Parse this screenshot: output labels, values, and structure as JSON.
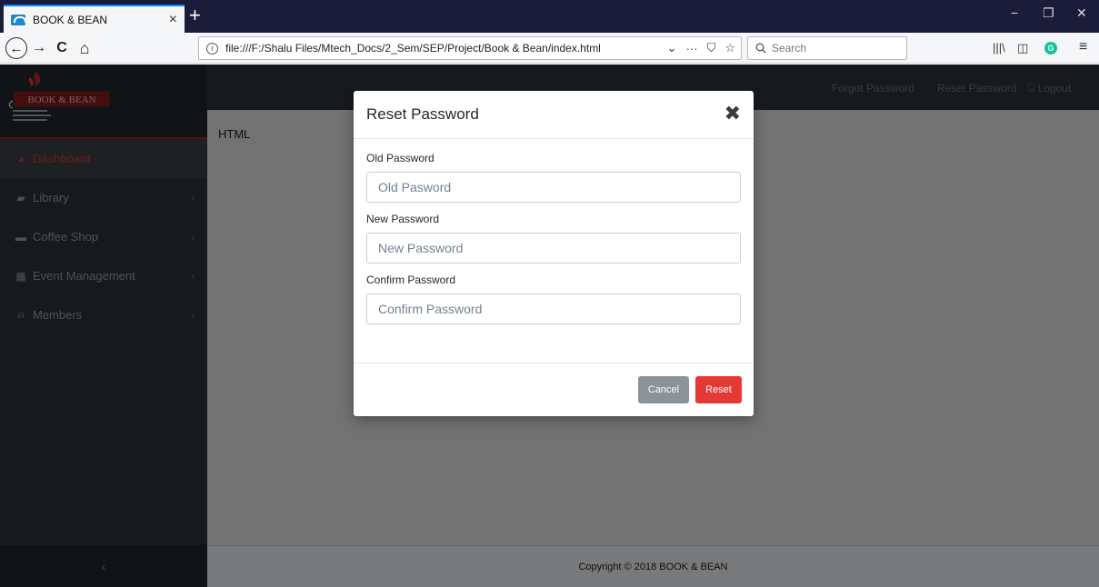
{
  "browser": {
    "tab_title": "BOOK & BEAN",
    "tab_close": "×",
    "new_tab": "+",
    "url": "file:///F:/Shalu Files/Mtech_Docs/2_Sem/SEP/Project/Book & Bean/index.html",
    "search_placeholder": "Search",
    "minimize": "−",
    "restore": "❐",
    "close": "✕",
    "back": "←",
    "forward": "→",
    "reload": "C",
    "home": "⌂",
    "url_dropdown": "⌄",
    "url_more": "···",
    "pocket": "⛉",
    "bookmark": "☆",
    "library": "|||\\",
    "sidebar_toggle": "◫",
    "grammarly": "G",
    "menu": "≡"
  },
  "brand": {
    "logo_text": "BOOK & BEAN",
    "colors": {
      "flame": "#c62828",
      "badge": "#8b1a1a"
    }
  },
  "sidebar": {
    "items": [
      {
        "label": "Dashboard",
        "icon": "dashboard-icon",
        "glyph": "◕",
        "active": true
      },
      {
        "label": "Library",
        "icon": "book-icon",
        "glyph": "▰",
        "chevron": "›"
      },
      {
        "label": "Coffee Shop",
        "icon": "coffee-icon",
        "glyph": "▬",
        "chevron": "›"
      },
      {
        "label": "Event Management",
        "icon": "calendar-icon",
        "glyph": "▦",
        "chevron": "›"
      },
      {
        "label": "Members",
        "icon": "user-icon",
        "glyph": "⍝",
        "chevron": "›"
      }
    ],
    "toggle": "‹"
  },
  "header": {
    "forgot_password": "Forgot Password",
    "reset_password": "Reset Password",
    "logout": "⍈ Logout"
  },
  "content": {
    "text": "HTML"
  },
  "footer": {
    "text": "Copyright © 2018 BOOK & BEAN"
  },
  "modal": {
    "title": "Reset Password",
    "close": "✖",
    "fields": [
      {
        "label": "Old Password",
        "placeholder": "Old Pasword",
        "value": ""
      },
      {
        "label": "New Password",
        "placeholder": "New Password",
        "value": ""
      },
      {
        "label": "Confirm Password",
        "placeholder": "Confirm Password",
        "value": ""
      }
    ],
    "cancel_label": "Cancel",
    "reset_label": "Reset",
    "colors": {
      "reset": "#e53935",
      "cancel": "#8a9399"
    }
  }
}
